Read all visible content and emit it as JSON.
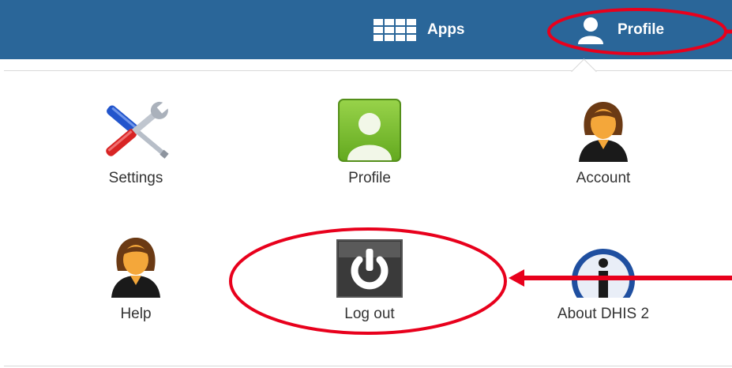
{
  "topbar": {
    "apps_label": "Apps",
    "profile_label": "Profile",
    "apps_icon": "apps-grid-icon",
    "profile_icon": "user-icon"
  },
  "menu": {
    "items": [
      {
        "label": "Settings",
        "icon": "settings-tools-icon"
      },
      {
        "label": "Profile",
        "icon": "profile-card-icon"
      },
      {
        "label": "Account",
        "icon": "account-person-icon"
      },
      {
        "label": "Help",
        "icon": "help-person-icon"
      },
      {
        "label": "Log out",
        "icon": "power-icon"
      },
      {
        "label": "About DHIS 2",
        "icon": "info-icon"
      }
    ]
  },
  "colors": {
    "topbar": "#2a6699",
    "annotation": "#e8001c",
    "profile_green": "#7cc232"
  }
}
